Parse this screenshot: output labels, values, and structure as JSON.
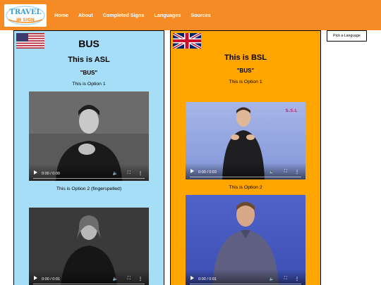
{
  "logo": {
    "line1": "TRAVEL",
    "line2": "IN SIGN"
  },
  "nav": [
    {
      "label": "Home"
    },
    {
      "label": "About"
    },
    {
      "label": "Completed Signs"
    },
    {
      "label": "Languages"
    },
    {
      "label": "Sources"
    }
  ],
  "pick_language": "Pick a Language",
  "asl": {
    "word_title": "BUS",
    "language_title": "This is ASL",
    "word_quoted": "\"BUS\"",
    "option1": "This is Option 1",
    "video1_time": "0:00 / 0:00",
    "option2": "This is Option 2 (fingerspelled)",
    "video2_time": "0:00 / 0:01"
  },
  "bsl": {
    "language_title": "This is BSL",
    "word_quoted": "\"BUS\"",
    "option1": "This is Option 1",
    "video1_time": "0:00 / 0:03",
    "video1_watermark": "S.S.L",
    "option2": "This is Option 2",
    "video2_time": "0:00 / 0:01"
  },
  "colors": {
    "header": "#f68b25",
    "asl_panel": "#a5def6",
    "bsl_panel": "#ffa500"
  },
  "icons": [
    "play-icon",
    "volume-icon",
    "fullscreen-icon",
    "more-options-icon",
    "us-flag-icon",
    "uk-flag-icon"
  ]
}
